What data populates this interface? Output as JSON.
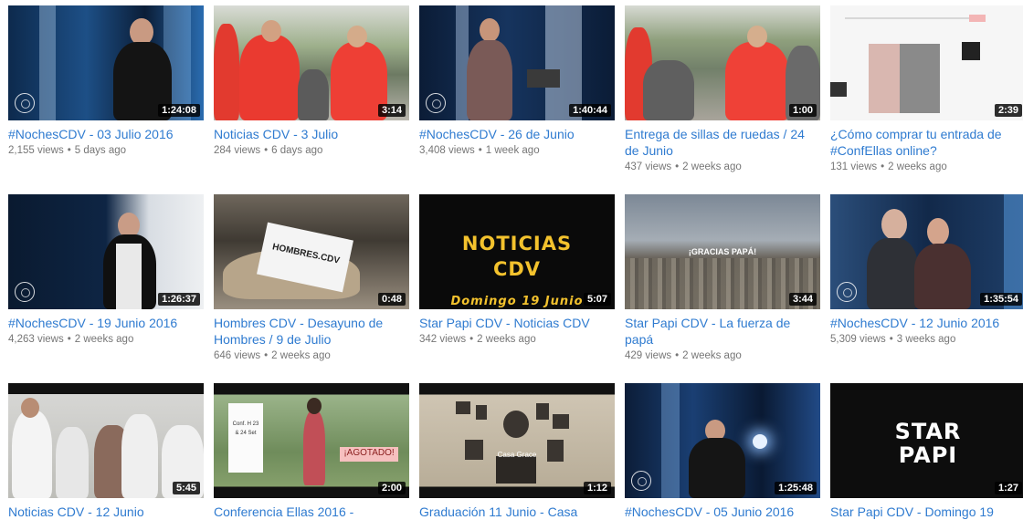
{
  "videos": [
    {
      "title": "#NochesCDV - 03 Julio 2016",
      "views": "2,155 views",
      "age": "5 days ago",
      "duration": "1:24:08"
    },
    {
      "title": "Noticias CDV - 3 Julio",
      "views": "284 views",
      "age": "6 days ago",
      "duration": "3:14"
    },
    {
      "title": "#NochesCDV - 26 de Junio",
      "views": "3,408 views",
      "age": "1 week ago",
      "duration": "1:40:44"
    },
    {
      "title": "Entrega de sillas de ruedas / 24 de Junio",
      "views": "437 views",
      "age": "2 weeks ago",
      "duration": "1:00"
    },
    {
      "title": "¿Cómo comprar tu entrada de #ConfEllas online?",
      "views": "131 views",
      "age": "2 weeks ago",
      "duration": "2:39"
    },
    {
      "title": "#NochesCDV - 19 Junio 2016",
      "views": "4,263 views",
      "age": "2 weeks ago",
      "duration": "1:26:37"
    },
    {
      "title": "Hombres CDV - Desayuno de Hombres / 9 de Julio",
      "views": "646 views",
      "age": "2 weeks ago",
      "duration": "0:48",
      "thumb_text": "HOMBRES.CDV"
    },
    {
      "title": "Star Papi CDV - Noticias CDV",
      "views": "342 views",
      "age": "2 weeks ago",
      "duration": "5:07",
      "thumb_text": "NOTICIAS CDV",
      "thumb_sub": "Domingo 19 Junio"
    },
    {
      "title": "Star Papi CDV - La fuerza de papá",
      "views": "429 views",
      "age": "2 weeks ago",
      "duration": "3:44",
      "thumb_text": "¡GRACIAS PAPÁ!"
    },
    {
      "title": "#NochesCDV - 12 Junio 2016",
      "views": "5,309 views",
      "age": "3 weeks ago",
      "duration": "1:35:54"
    },
    {
      "title": "Noticias CDV - 12 Junio",
      "views": "",
      "age": "",
      "duration": "5:45"
    },
    {
      "title": "Conferencia Ellas 2016 -",
      "views": "",
      "age": "",
      "duration": "2:00",
      "thumb_text": "¡AGOTADO!",
      "thumb_card": "Conf. H 23 & 24 Set"
    },
    {
      "title": "Graduación 11 Junio - Casa",
      "views": "",
      "age": "",
      "duration": "1:12",
      "thumb_text": "Casa Grace"
    },
    {
      "title": "#NochesCDV - 05 Junio 2016",
      "views": "",
      "age": "",
      "duration": "1:25:48"
    },
    {
      "title": "Star Papi CDV - Domingo 19",
      "views": "",
      "age": "",
      "duration": "1:27",
      "thumb_text": "STAR PAPI"
    }
  ],
  "colors": {
    "title": "#2f7bd0",
    "meta": "#767676",
    "badge": "#000000"
  }
}
